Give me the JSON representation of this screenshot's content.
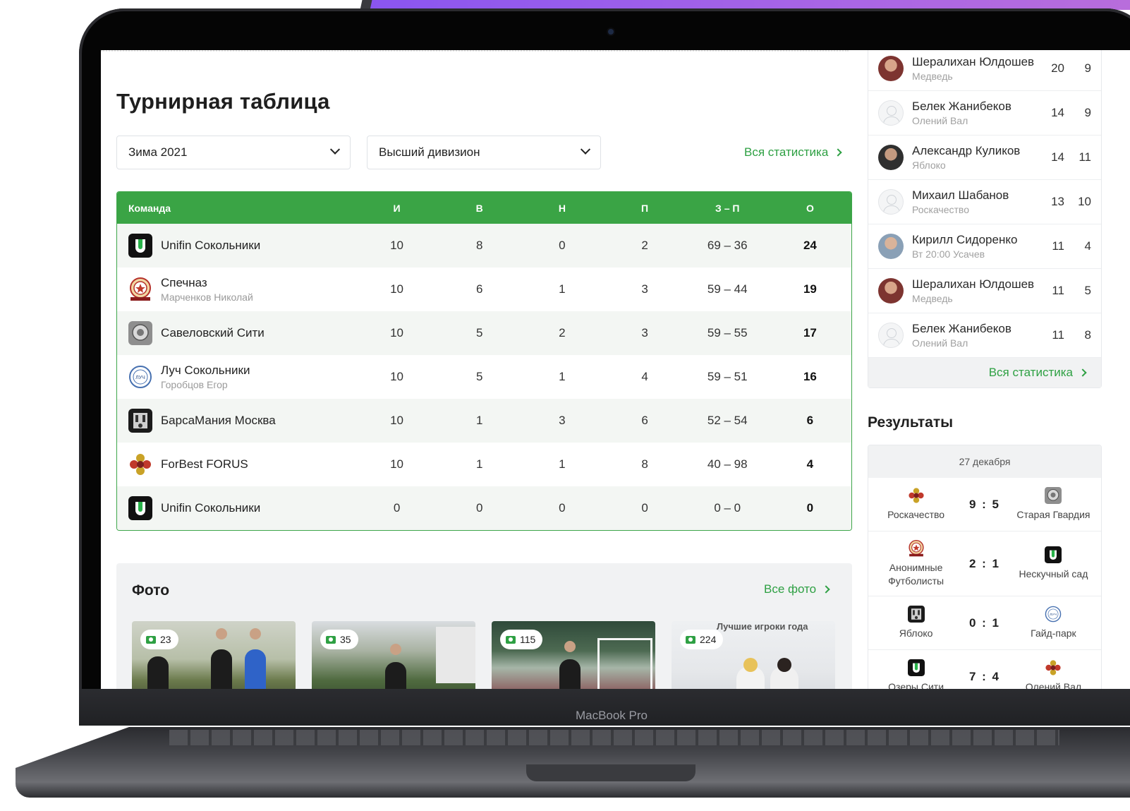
{
  "device": {
    "label": "MacBook Pro"
  },
  "page": {
    "title": "Турнирная таблица"
  },
  "filters": {
    "season": "Зима 2021",
    "division": "Высший дивизион",
    "all_stats_link": "Вся статистика"
  },
  "standings": {
    "headers": [
      "Команда",
      "И",
      "В",
      "Н",
      "П",
      "З – П",
      "О"
    ],
    "rows": [
      {
        "team": "Unifin Сокольники",
        "sub": "",
        "logo": "unifin-logo",
        "played": "10",
        "won": "8",
        "draw": "0",
        "lost": "2",
        "goals": "69 – 36",
        "points": "24"
      },
      {
        "team": "Спечназ",
        "sub": "Марченков Николай",
        "logo": "spechnaz-logo",
        "played": "10",
        "won": "6",
        "draw": "1",
        "lost": "3",
        "goals": "59 – 44",
        "points": "19"
      },
      {
        "team": "Савеловский Сити",
        "sub": "",
        "logo": "savelovsky-logo",
        "played": "10",
        "won": "5",
        "draw": "2",
        "lost": "3",
        "goals": "59 – 55",
        "points": "17"
      },
      {
        "team": "Луч Сокольники",
        "sub": "Горобцов Егор",
        "logo": "luch-logo",
        "played": "10",
        "won": "5",
        "draw": "1",
        "lost": "4",
        "goals": "59 – 51",
        "points": "16"
      },
      {
        "team": "БарсаМания Москва",
        "sub": "",
        "logo": "barsamania-logo",
        "played": "10",
        "won": "1",
        "draw": "3",
        "lost": "6",
        "goals": "52 – 54",
        "points": "6"
      },
      {
        "team": "ForBest FORUS",
        "sub": "",
        "logo": "forbest-logo",
        "played": "10",
        "won": "1",
        "draw": "1",
        "lost": "8",
        "goals": "40 – 98",
        "points": "4"
      },
      {
        "team": "Unifin Сокольники",
        "sub": "",
        "logo": "unifin-logo",
        "played": "0",
        "won": "0",
        "draw": "0",
        "lost": "0",
        "goals": "0 – 0",
        "points": "0"
      }
    ]
  },
  "photos": {
    "title": "Фото",
    "all_link": "Все фото",
    "albums": [
      {
        "count": "23"
      },
      {
        "count": "35"
      },
      {
        "count": "115"
      },
      {
        "count": "224",
        "caption": "Лучшие игроки года"
      }
    ]
  },
  "scorers": {
    "rows": [
      {
        "name": "Шералихан Юлдошев",
        "team": "Медведь",
        "a": "20",
        "b": "9",
        "avatar": "photo-a"
      },
      {
        "name": "Белек Жанибеков",
        "team": "Олений Вал",
        "a": "14",
        "b": "9",
        "avatar": "empty"
      },
      {
        "name": "Александр Куликов",
        "team": "Яблоко",
        "a": "14",
        "b": "11",
        "avatar": "photo-b"
      },
      {
        "name": "Михаил Шабанов",
        "team": "Роскачество",
        "a": "13",
        "b": "10",
        "avatar": "empty"
      },
      {
        "name": "Кирилл Сидоренко",
        "team": "Вт 20:00 Усачев",
        "a": "11",
        "b": "4",
        "avatar": "photo-c"
      },
      {
        "name": "Шералихан Юлдошев",
        "team": "Медведь",
        "a": "11",
        "b": "5",
        "avatar": "photo-a"
      },
      {
        "name": "Белек Жанибеков",
        "team": "Олений Вал",
        "a": "11",
        "b": "8",
        "avatar": "empty"
      }
    ],
    "all_link": "Вся статистика"
  },
  "results": {
    "title": "Результаты",
    "date": "27 декабря",
    "matches": [
      {
        "home": "Роскачество",
        "score": "9 : 5",
        "away": "Старая Гвардия"
      },
      {
        "home": "Анонимные Футболисты",
        "score": "2 : 1",
        "away": "Нескучный сад"
      },
      {
        "home": "Яблоко",
        "score": "0 : 1",
        "away": "Гайд-парк"
      },
      {
        "home": "Озеры Сити",
        "score": "7 : 4",
        "away": "Олений Вал"
      }
    ]
  },
  "colors": {
    "accent": "#3aa445",
    "link": "#2ea043",
    "backdrop": "#a865e6"
  }
}
